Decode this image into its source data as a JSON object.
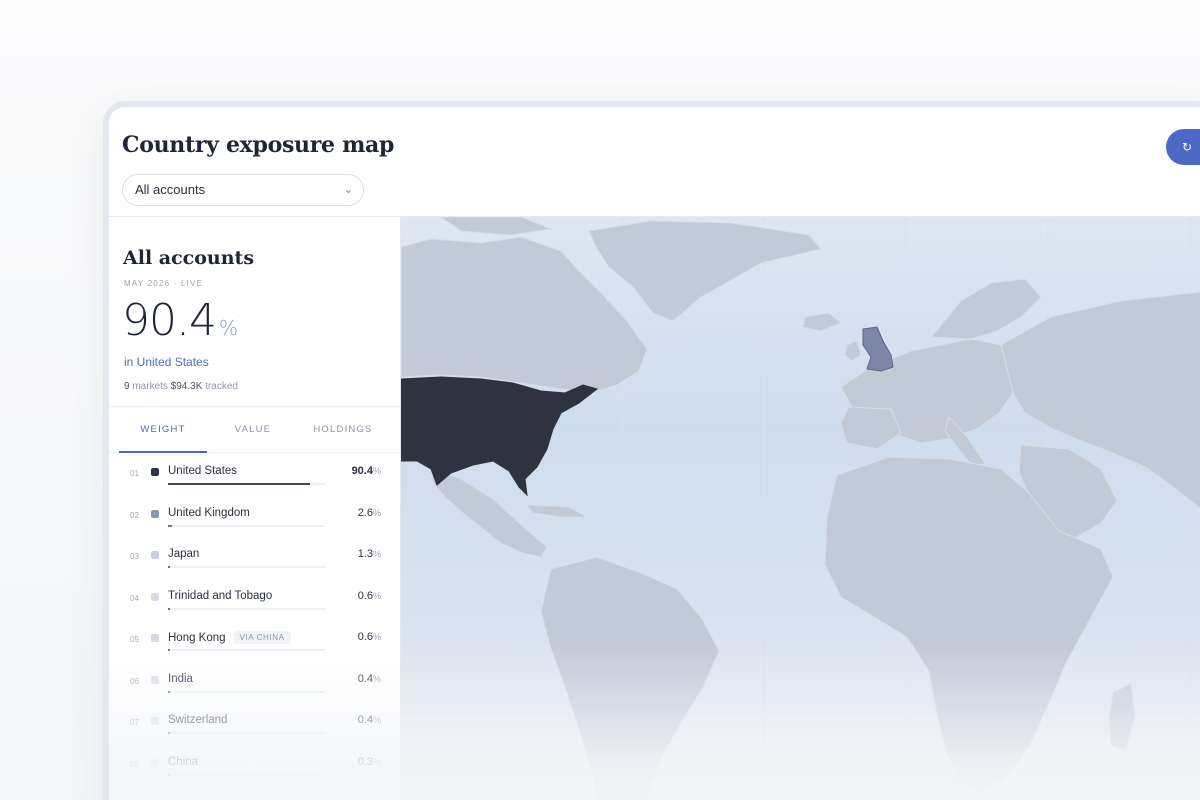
{
  "header": {
    "title": "Country exposure map",
    "account_select": "All accounts",
    "refresh_icon": "refresh-icon"
  },
  "panel": {
    "title": "All accounts",
    "subtitle": "MAY 2026 · LIVE",
    "big_value": "90.4",
    "big_unit": "%",
    "in_country": "in United States",
    "markets_count": "9",
    "markets_label": "markets",
    "tracked_value": "$94.3K",
    "tracked_label": "tracked",
    "tabs": [
      "WEIGHT",
      "VALUE",
      "HOLDINGS"
    ],
    "active_tab": "WEIGHT"
  },
  "rows": [
    {
      "num": "01",
      "name": "United States",
      "value": "90.4",
      "unit": "%",
      "weight": 0.904,
      "color": "#2f3542"
    },
    {
      "num": "02",
      "name": "United Kingdom",
      "value": "2.6",
      "unit": "%",
      "weight": 0.026,
      "color": "#8f97b6"
    },
    {
      "num": "03",
      "name": "Japan",
      "value": "1.3",
      "unit": "%",
      "weight": 0.013,
      "color": "#c9cfdc"
    },
    {
      "num": "04",
      "name": "Trinidad and Tobago",
      "value": "0.6",
      "unit": "%",
      "weight": 0.006,
      "color": "#d5dae3"
    },
    {
      "num": "05",
      "name": "Hong Kong",
      "tag": "VIA CHINA",
      "value": "0.6",
      "unit": "%",
      "weight": 0.006,
      "color": "#d5dae3"
    },
    {
      "num": "06",
      "name": "India",
      "value": "0.4",
      "unit": "%",
      "weight": 0.004,
      "color": "#dde1e9"
    },
    {
      "num": "07",
      "name": "Switzerland",
      "value": "0.4",
      "unit": "%",
      "weight": 0.004,
      "color": "#dde1e9"
    },
    {
      "num": "08",
      "name": "China",
      "value": "0.3",
      "unit": "%",
      "weight": 0.003,
      "color": "#e2e6ec"
    }
  ],
  "map": {
    "highlight_us": "#2e333f",
    "highlight_uk": "#7e86a8",
    "land": "#c3cad7",
    "ocean": "#d3deee"
  }
}
